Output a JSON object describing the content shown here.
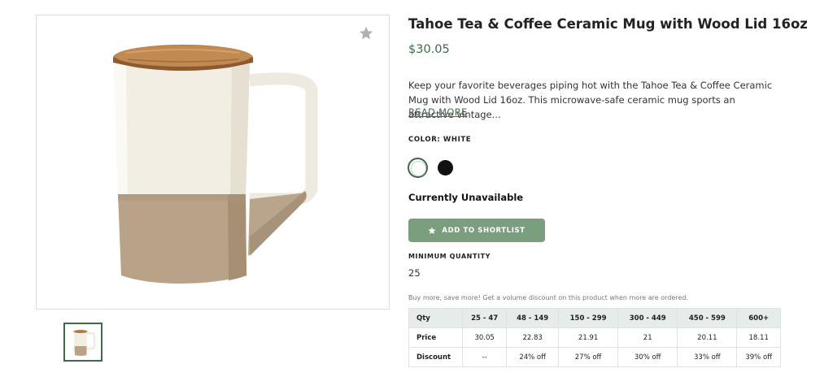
{
  "product": {
    "title": "Tahoe Tea & Coffee Ceramic Mug with Wood Lid 16oz",
    "price": "$30.05",
    "description": "Keep your favorite beverages piping hot with the Tahoe Tea & Coffee Ceramic Mug with Wood Lid 16oz. This microwave-safe ceramic mug sports an attractive vintage...",
    "read_more": "READ MORE",
    "color_label": "COLOR: WHITE",
    "colors": [
      {
        "name": "white",
        "hex": "#ffffff",
        "selected": true
      },
      {
        "name": "black",
        "hex": "#111111",
        "selected": false
      }
    ],
    "availability": "Currently Unavailable",
    "shortlist_button": "ADD TO SHORTLIST",
    "min_qty_label": "MINIMUM QUANTITY",
    "min_qty_value": "25",
    "volume_note": "Buy more, save more! Get a volume discount on this product when more are ordered."
  },
  "pricing_table": {
    "headers": [
      "Qty",
      "25 - 47",
      "48 - 149",
      "150 - 299",
      "300 - 449",
      "450 - 599",
      "600+"
    ],
    "rows": [
      {
        "label": "Price",
        "cells": [
          "30.05",
          "22.83",
          "21.91",
          "21",
          "20.11",
          "18.11"
        ]
      },
      {
        "label": "Discount",
        "cells": [
          "--",
          "24% off",
          "27% off",
          "30% off",
          "33% off",
          "39% off"
        ]
      }
    ]
  },
  "icons": {
    "favorite": "star-icon",
    "shortlist": "star-icon"
  },
  "colors": {
    "accent": "#3d6b45",
    "button": "#7a9e7e",
    "table_header_bg": "#e6ece7"
  }
}
